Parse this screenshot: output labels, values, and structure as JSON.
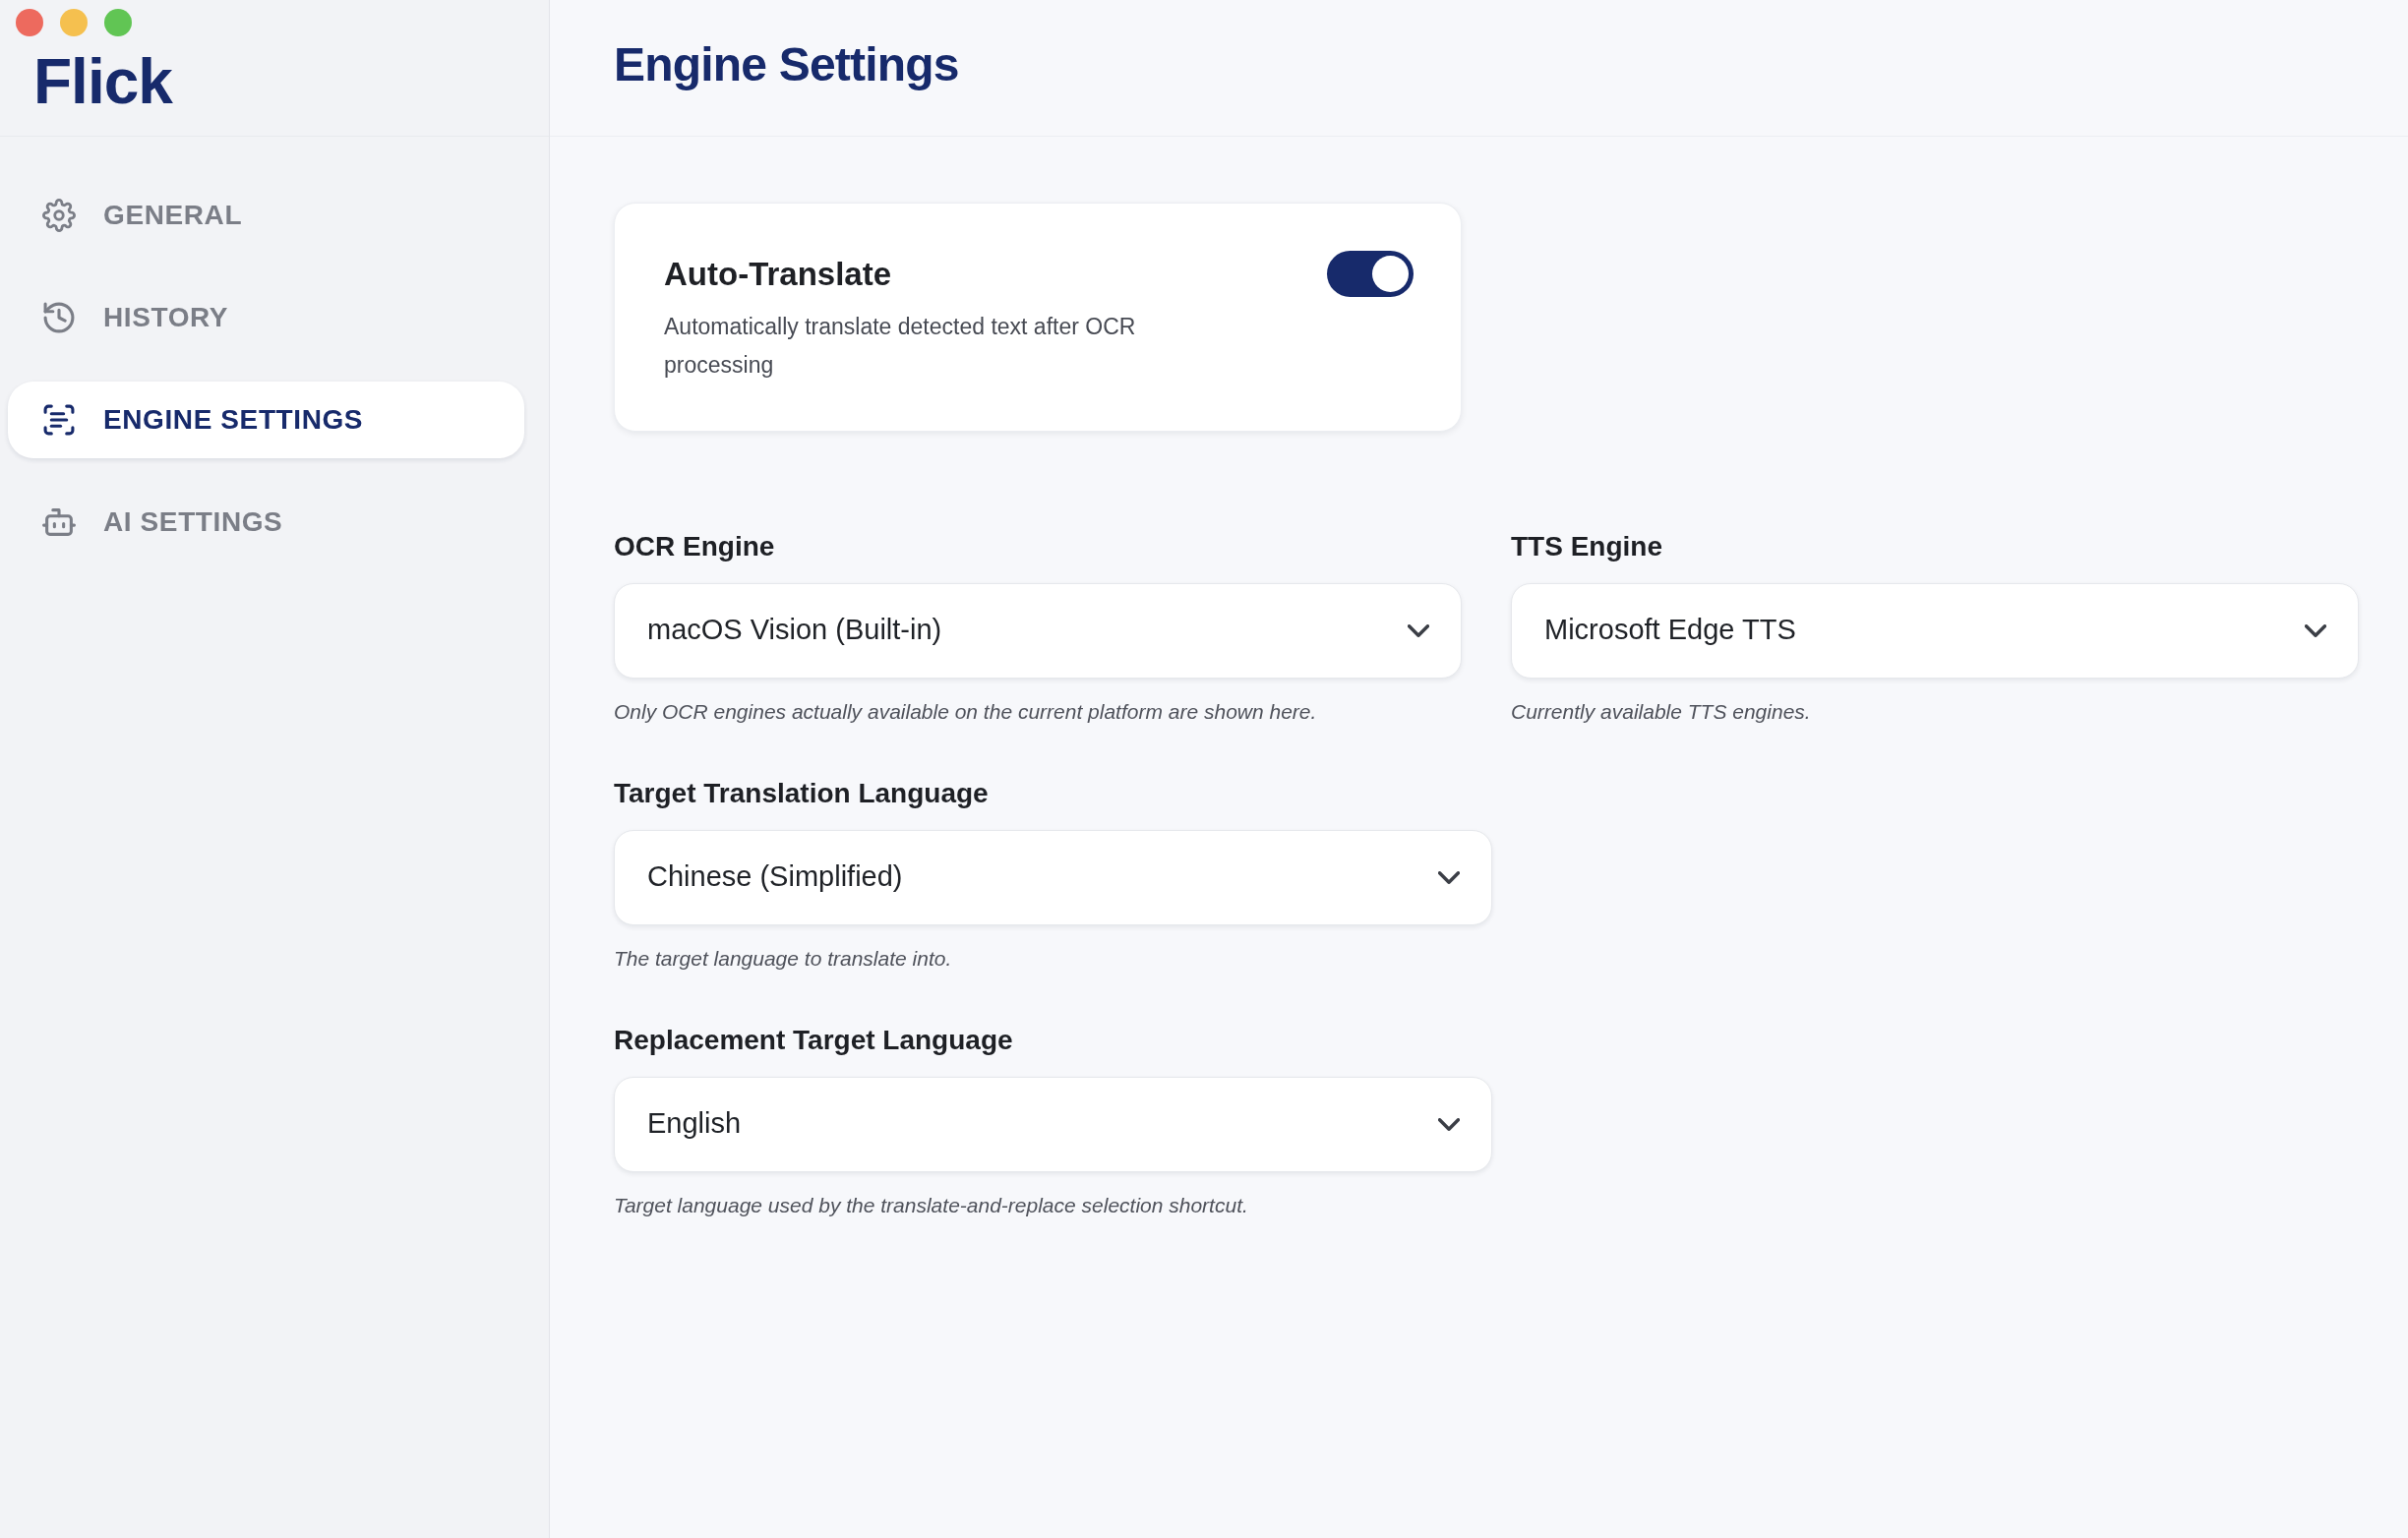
{
  "sidebar": {
    "logo": "Flick",
    "items": [
      {
        "label": "GENERAL",
        "selected": false
      },
      {
        "label": "HISTORY",
        "selected": false
      },
      {
        "label": "ENGINE SETTINGS",
        "selected": true
      },
      {
        "label": "AI SETTINGS",
        "selected": false
      }
    ]
  },
  "header": {
    "title": "Engine Settings"
  },
  "auto_translate": {
    "title": "Auto-Translate",
    "description": "Automatically translate detected text after OCR processing",
    "on": true
  },
  "field_rows": [
    {
      "fields": [
        {
          "label": "OCR Engine",
          "value": "macOS Vision (Built-in)",
          "hint": "Only OCR engines actually available on the current platform are shown here."
        },
        {
          "label": "TTS Engine",
          "value": "Microsoft Edge TTS",
          "hint": "Currently available TTS engines."
        }
      ]
    },
    {
      "fields": [
        {
          "label": "Target Translation Language",
          "value": "Chinese (Simplified)",
          "hint": "The target language to translate into."
        }
      ]
    },
    {
      "fields": [
        {
          "label": "Replacement Target Language",
          "value": "English",
          "hint": "Target language used by the translate-and-replace selection shortcut."
        }
      ]
    }
  ]
}
